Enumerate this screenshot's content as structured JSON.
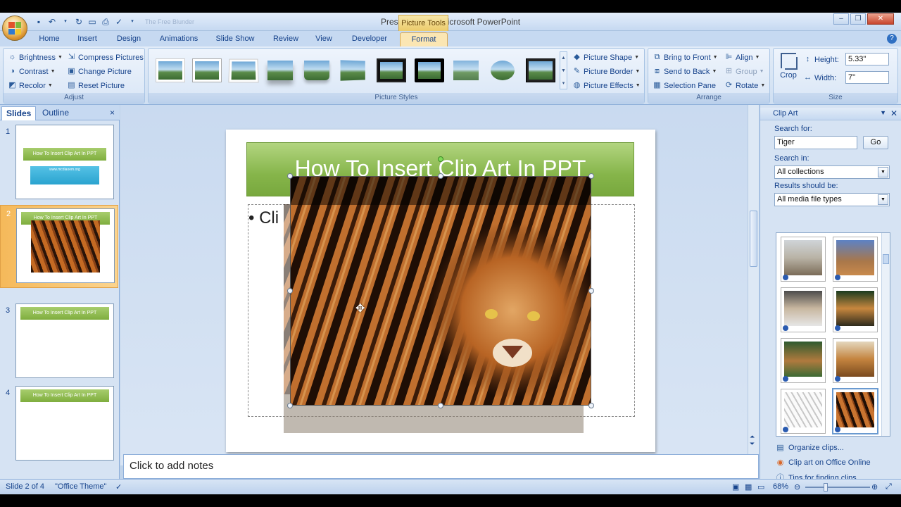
{
  "window": {
    "title": "Presentation1 - Microsoft PowerPoint",
    "context_tab": "Picture Tools",
    "qat_extra": "The Free Blunder"
  },
  "tabs": [
    "Home",
    "Insert",
    "Design",
    "Animations",
    "Slide Show",
    "Review",
    "View",
    "Developer",
    "Format"
  ],
  "active_tab": "Format",
  "ribbon": {
    "adjust": {
      "label": "Adjust",
      "brightness": "Brightness",
      "contrast": "Contrast",
      "recolor": "Recolor",
      "compress": "Compress Pictures",
      "change": "Change Picture",
      "reset": "Reset Picture"
    },
    "styles": {
      "label": "Picture Styles",
      "shape": "Picture Shape",
      "border": "Picture Border",
      "effects": "Picture Effects"
    },
    "arrange": {
      "label": "Arrange",
      "front": "Bring to Front",
      "back": "Send to Back",
      "selection": "Selection Pane",
      "align": "Align",
      "group": "Group",
      "rotate": "Rotate"
    },
    "size": {
      "label": "Size",
      "crop": "Crop",
      "height_label": "Height:",
      "height": "5.33\"",
      "width_label": "Width:",
      "width": "7\""
    }
  },
  "slides_pane": {
    "tab_slides": "Slides",
    "tab_outline": "Outline",
    "close": "×",
    "slides": [
      {
        "num": "1",
        "title": "How To Insert Clip Art In PPT",
        "subtitle": "www.mcdiaoem.org"
      },
      {
        "num": "2",
        "title": "How To Insert Clip Art In PPT"
      },
      {
        "num": "3",
        "title": "How To Insert Clip Art In PPT"
      },
      {
        "num": "4",
        "title": "How To Insert Clip Art In PPT"
      }
    ]
  },
  "slide": {
    "title": "How To Insert Clip Art In PPT",
    "bullet": "Cli"
  },
  "notes": "Click to add notes",
  "clipart": {
    "title": "Clip Art",
    "search_for_label": "Search for:",
    "search_value": "Tiger",
    "go": "Go",
    "search_in_label": "Search in:",
    "search_in_value": "All collections",
    "results_label": "Results should be:",
    "results_value": "All media file types",
    "links": [
      "Organize clips...",
      "Clip art on Office Online",
      "Tips for finding clips"
    ]
  },
  "status": {
    "slide_of": "Slide 2 of 4",
    "theme": "\"Office Theme\"",
    "zoom": "68%"
  }
}
